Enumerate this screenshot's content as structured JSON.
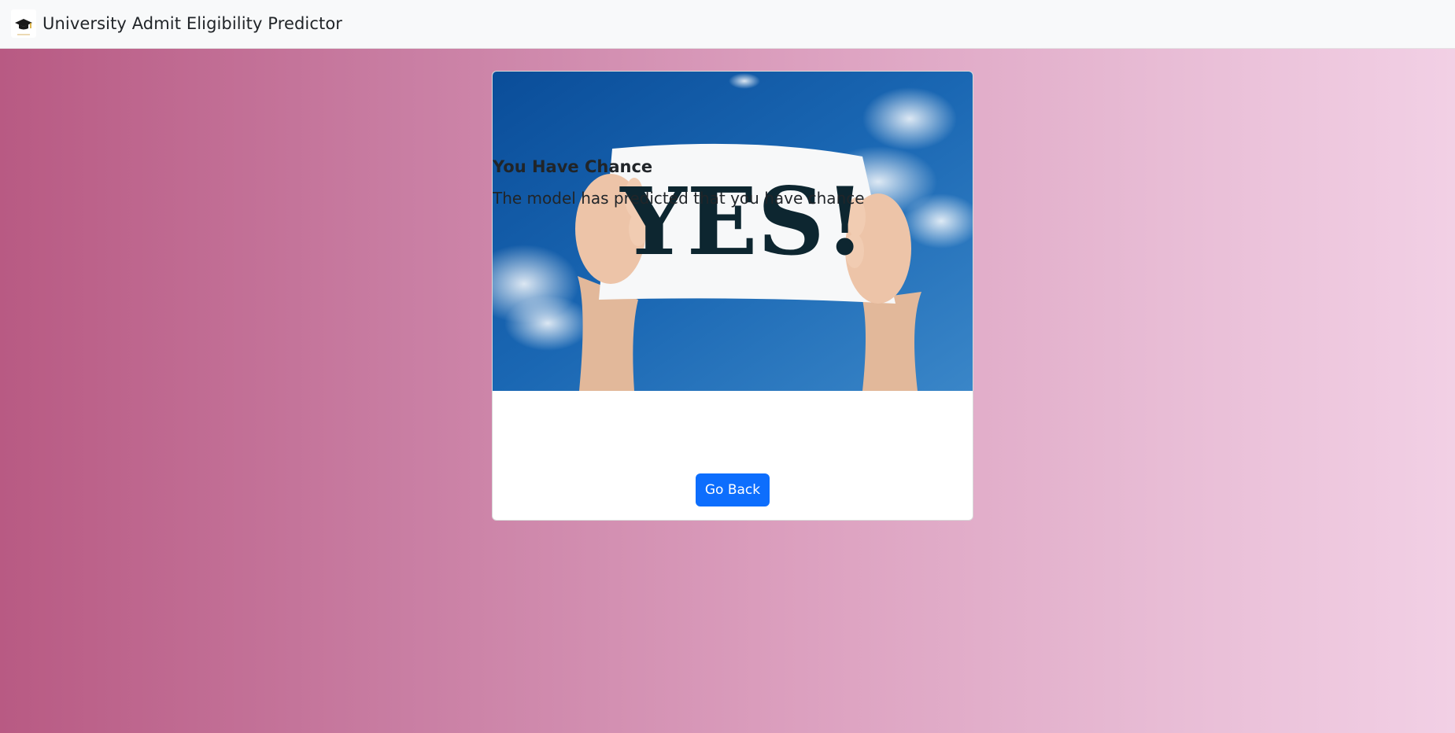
{
  "navbar": {
    "brand_icon": "graduation-cap-icon",
    "brand_text": "University Admit Eligibility Predictor"
  },
  "result": {
    "image_sign_text": "YES!",
    "title": "You Have Chance",
    "message": "The model has predicted that you have chance",
    "button_label": "Go Back"
  },
  "colors": {
    "navbar_bg": "#f8f9fa",
    "button_bg": "#0d6efd",
    "gradient_start": "#b85a83",
    "gradient_end": "#f2d0e5"
  }
}
